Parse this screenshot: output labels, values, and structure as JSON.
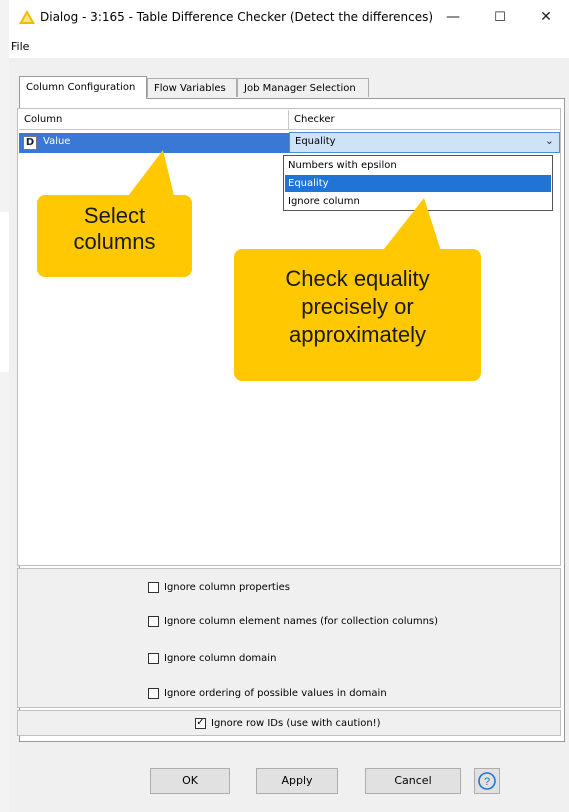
{
  "window": {
    "title": "Dialog - 3:165 - Table Difference Checker (Detect the differences)",
    "minimize_glyph": "—",
    "maximize_glyph": "☐",
    "close_glyph": "✕"
  },
  "menu": {
    "file": "File"
  },
  "tabs": [
    {
      "label": "Column Configuration",
      "active": true
    },
    {
      "label": "Flow Variables",
      "active": false
    },
    {
      "label": "Job Manager Selection",
      "active": false
    }
  ],
  "table": {
    "headers": [
      "Column",
      "Checker"
    ],
    "row": {
      "type_badge": "D",
      "column": "Value",
      "checker": "Equality"
    },
    "dropdown_options": [
      "Numbers with epsilon",
      "Equality",
      "Ignore column"
    ],
    "dropdown_selected": "Equality"
  },
  "callouts": {
    "select_line1": "Select",
    "select_line2": "columns",
    "check_line1": "Check equality",
    "check_line2": "precisely or",
    "check_line3": "approximately"
  },
  "options": [
    {
      "label": "Ignore column properties",
      "checked": false
    },
    {
      "label": "Ignore column element names (for collection columns)",
      "checked": false
    },
    {
      "label": "Ignore column domain",
      "checked": false
    },
    {
      "label": "Ignore ordering of possible values in domain",
      "checked": false
    }
  ],
  "row_ids_option": {
    "label": "Ignore row IDs (use with caution!)",
    "checked": true
  },
  "buttons": {
    "ok": "OK",
    "apply": "Apply",
    "cancel": "Cancel",
    "help_glyph": "?"
  },
  "colors": {
    "selection": "#3a78d6",
    "callout": "#ffc800",
    "warning_icon": "#f5b800"
  }
}
